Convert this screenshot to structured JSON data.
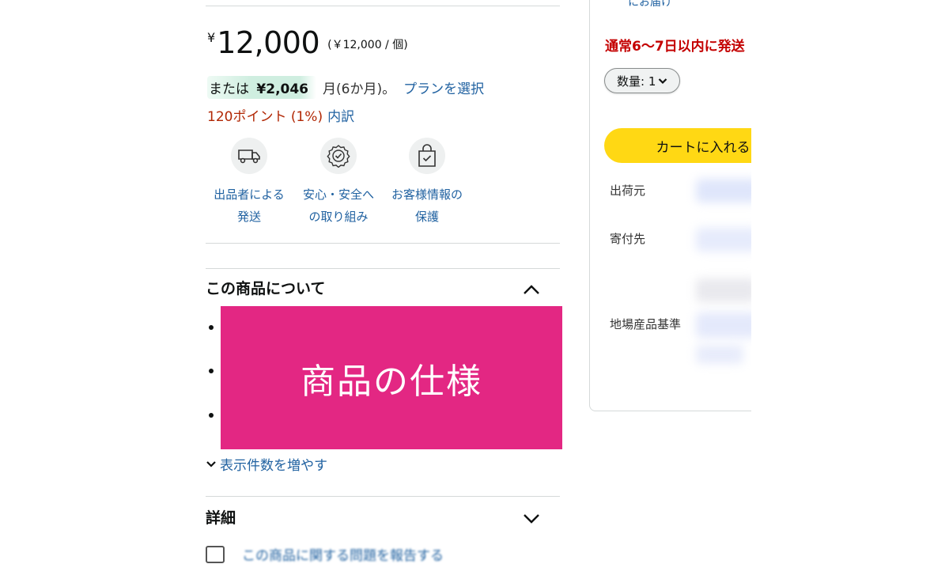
{
  "price": {
    "symbol": "¥",
    "amount": "12,000",
    "unit_price": "(￥12,000 / 個)"
  },
  "installment": {
    "prefix": "または",
    "amount": "¥2,046",
    "term": "月(6か月)。",
    "plan_link": "プランを選択"
  },
  "points": {
    "text": "120ポイント (1%)",
    "breakdown_link": "内訳"
  },
  "features": [
    {
      "icon": "delivery-van-icon",
      "line1": "出品者による",
      "line2": "発送"
    },
    {
      "icon": "safety-badge-icon",
      "line1": "安心・安全へ",
      "line2": "の取り組み"
    },
    {
      "icon": "secure-bag-icon",
      "line1": "お客様情報の",
      "line2": "保護"
    }
  ],
  "about": {
    "title": "この商品について",
    "overlay_text": "商品の仕様",
    "show_more": "表示件数を増やす"
  },
  "details": {
    "title": "詳細",
    "report_link": "この商品に関する問題を報告する"
  },
  "buybox": {
    "top_link": "にお届け",
    "delivery_text": "通常6〜7日以内に発送",
    "quantity": "数量: 1",
    "cart_button": "カートに入れる",
    "ship_from_label": "出荷元",
    "donation_label": "寄付先",
    "local_product_label": "地場産品基準"
  },
  "colors": {
    "link": "#2162a1",
    "price_red": "#b12704",
    "delivery_red": "#c40000",
    "cart_yellow": "#ffd814",
    "overlay_pink": "#e32783"
  }
}
